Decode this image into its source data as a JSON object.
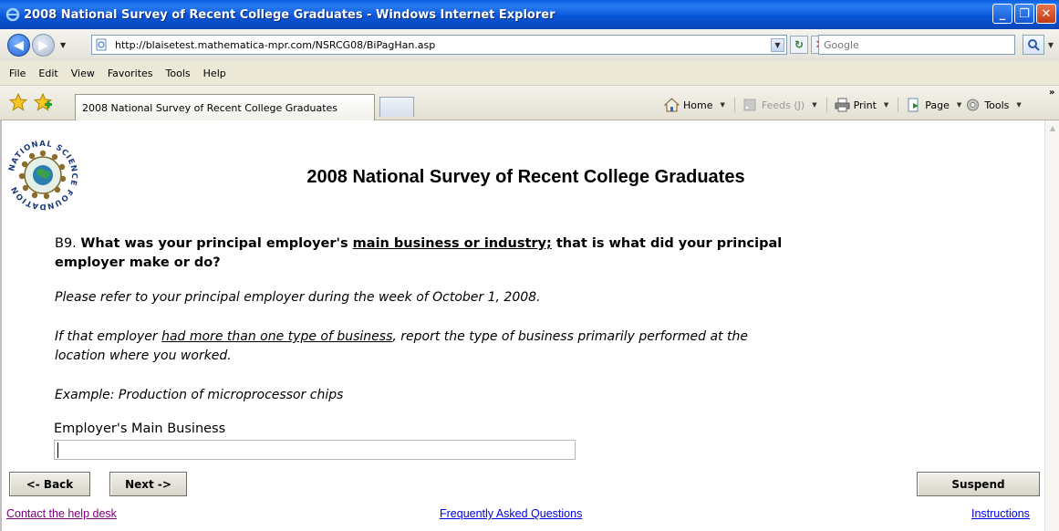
{
  "window": {
    "title": "2008 National Survey of Recent College Graduates - Windows Internet Explorer"
  },
  "address": {
    "url": "http://blaisetest.mathematica-mpr.com/NSRCG08/BiPagHan.asp",
    "search_placeholder": "Google"
  },
  "menu": [
    "File",
    "Edit",
    "View",
    "Favorites",
    "Tools",
    "Help"
  ],
  "tabs": {
    "active": "2008 National Survey of Recent College Graduates"
  },
  "command_bar": {
    "home": "Home",
    "feeds": "Feeds (J)",
    "print": "Print",
    "page": "Page",
    "tools": "Tools"
  },
  "page": {
    "logo_text": "NATIONAL SCIENCE FOUNDATION",
    "title": "2008 National Survey of Recent College Graduates",
    "question": {
      "number": "B9.",
      "text_before": "What was your principal employer's ",
      "underlined": "main business or industry;",
      "text_after": " that is what did your principal",
      "line2": "employer make or do?"
    },
    "instruction1": "Please refer to your principal employer during the week of October 1, 2008.",
    "instruction2_before": "If that employer ",
    "instruction2_underlined": "had more than one type of business",
    "instruction2_after": ", report the type of business primarily performed at the",
    "instruction2_line2": "location where you worked.",
    "example": "Example: Production of microprocessor chips",
    "field_label": "Employer's Main Business",
    "field_value": ""
  },
  "buttons": {
    "back": "<- Back",
    "next": "Next ->",
    "suspend": "Suspend"
  },
  "links": {
    "help": "Contact the help desk",
    "faq": "Frequently Asked Questions",
    "instructions": "Instructions"
  }
}
